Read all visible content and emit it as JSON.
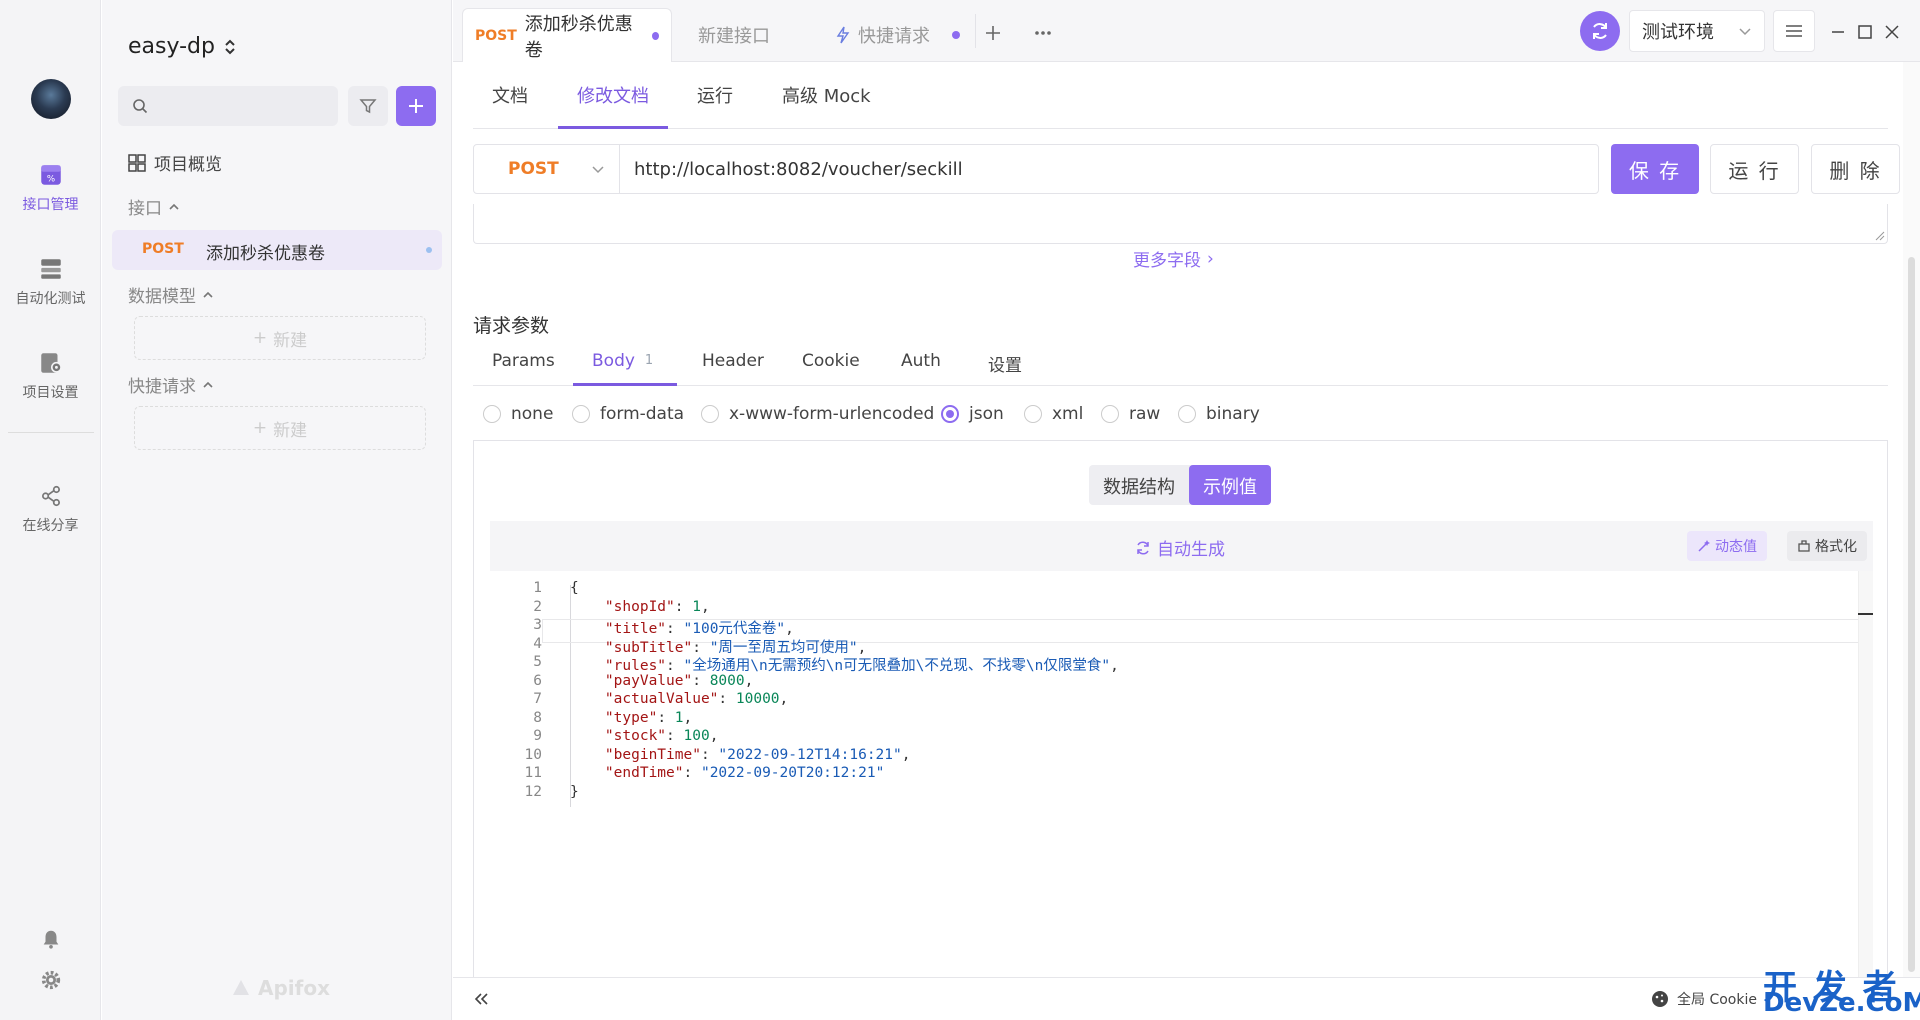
{
  "rail": {
    "items": [
      {
        "label": "接口管理"
      },
      {
        "label": "自动化测试"
      },
      {
        "label": "项目设置"
      },
      {
        "label": "在线分享"
      }
    ]
  },
  "project": {
    "name": "easy-dp",
    "overview": "项目概览",
    "sec_api": "接口",
    "api_item": {
      "method": "POST",
      "name": "添加秒杀优惠卷"
    },
    "sec_model": "数据模型",
    "sec_quick": "快捷请求",
    "new_label": "新建",
    "brand": "Apifox"
  },
  "tabs": [
    {
      "method": "POST",
      "label": "添加秒杀优惠卷"
    },
    {
      "label": "新建接口"
    },
    {
      "label": "快捷请求"
    }
  ],
  "env": {
    "label": "测试环境"
  },
  "subtabs": [
    "文档",
    "修改文档",
    "运行",
    "高级 Mock"
  ],
  "request": {
    "method": "POST",
    "url": "http://localhost:8082/voucher/seckill",
    "save": "保 存",
    "run": "运 行",
    "delete": "删 除",
    "more_fields": "更多字段"
  },
  "params": {
    "title": "请求参数",
    "tabs": [
      "Params",
      "Body",
      "Header",
      "Cookie",
      "Auth",
      "设置"
    ],
    "body_count": "1"
  },
  "body_types": [
    "none",
    "form-data",
    "x-www-form-urlencoded",
    "json",
    "xml",
    "raw",
    "binary"
  ],
  "body_selected": "json",
  "view_toggle": [
    "数据结构",
    "示例值"
  ],
  "editor": {
    "auto_gen": "自动生成",
    "dynamic": "动态值",
    "format": "格式化",
    "lines": [
      {
        "n": "1",
        "t": "{"
      },
      {
        "n": "2",
        "k": "\"shopId\"",
        "v": "1",
        "vt": "n",
        "c": ","
      },
      {
        "n": "3",
        "k": "\"title\"",
        "v": "\"100元代金卷\"",
        "vt": "s",
        "c": ","
      },
      {
        "n": "4",
        "k": "\"subTitle\"",
        "v": "\"周一至周五均可使用\"",
        "vt": "s",
        "c": ","
      },
      {
        "n": "5",
        "k": "\"rules\"",
        "v": "\"全场通用\\n无需预约\\n可无限叠加\\不兑现、不找零\\n仅限堂食\"",
        "vt": "s",
        "c": ","
      },
      {
        "n": "6",
        "k": "\"payValue\"",
        "v": "8000",
        "vt": "n",
        "c": ","
      },
      {
        "n": "7",
        "k": "\"actualValue\"",
        "v": "10000",
        "vt": "n",
        "c": ","
      },
      {
        "n": "8",
        "k": "\"type\"",
        "v": "1",
        "vt": "n",
        "c": ","
      },
      {
        "n": "9",
        "k": "\"stock\"",
        "v": "100",
        "vt": "n",
        "c": ","
      },
      {
        "n": "10",
        "k": "\"beginTime\"",
        "v": "\"2022-09-12T14:16:21\"",
        "vt": "s",
        "c": ","
      },
      {
        "n": "11",
        "k": "\"endTime\"",
        "v": "\"2022-09-20T20:12:21\"",
        "vt": "s",
        "c": ""
      },
      {
        "n": "12",
        "t": "}"
      }
    ]
  },
  "footer": {
    "cookie": "全局 Cookie",
    "watermark": "开 发 者",
    "watermark2": "DevZe.CoM"
  }
}
